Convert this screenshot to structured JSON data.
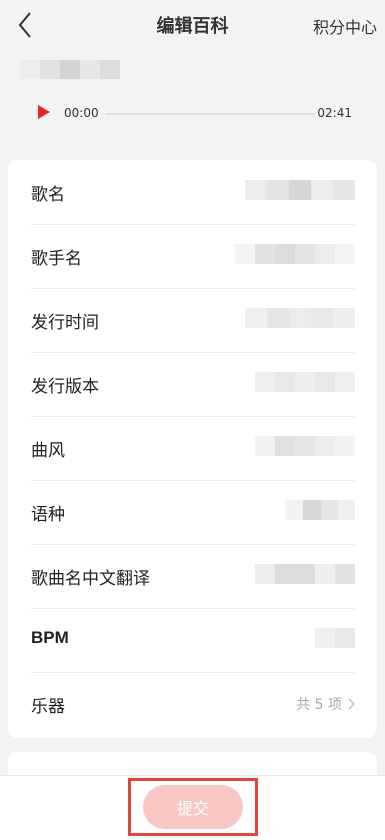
{
  "header": {
    "title": "编辑百科",
    "points_link": "积分中心"
  },
  "player": {
    "current_time": "00:00",
    "total_time": "02:41",
    "progress": 0
  },
  "fields": [
    {
      "label": "歌名"
    },
    {
      "label": "歌手名"
    },
    {
      "label": "发行时间"
    },
    {
      "label": "发行版本"
    },
    {
      "label": "曲风"
    },
    {
      "label": "语种"
    },
    {
      "label": "歌曲名中文翻译"
    },
    {
      "label": "BPM"
    },
    {
      "label": "乐器",
      "value": "共 5 项"
    }
  ],
  "footer": {
    "submit_label": "提交"
  },
  "colors": {
    "accent": "#e0463d",
    "submit_disabled": "#f8c7c4",
    "play_icon": "#e02a2a"
  }
}
